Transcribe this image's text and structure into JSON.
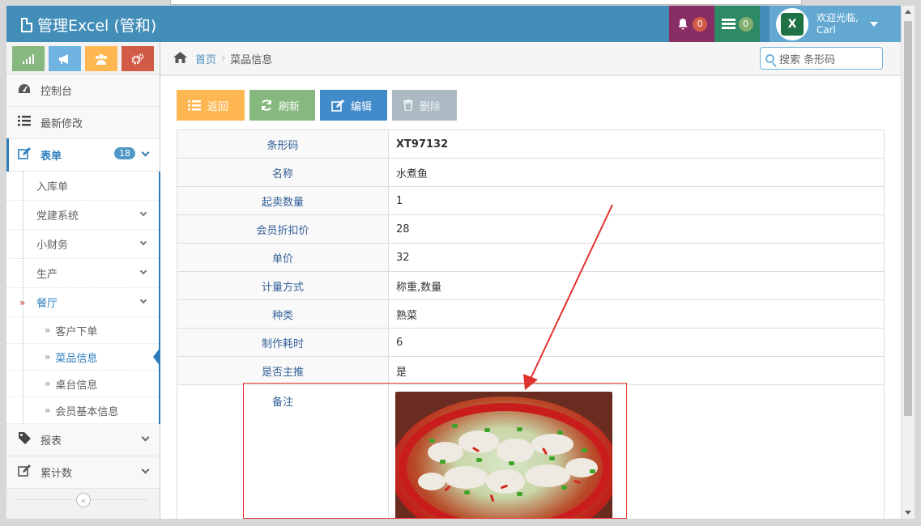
{
  "app": {
    "title": "管理Excel (管和)"
  },
  "navbar": {
    "notifications_count": "0",
    "tasks_count": "0",
    "user_greeting": "欢迎光临,",
    "user_name": "Carl",
    "avatar_text": "X"
  },
  "shortcuts": [
    {
      "icon": "signal-icon",
      "color": "#87b87f"
    },
    {
      "icon": "bullhorn-icon",
      "color": "#6fb3e0"
    },
    {
      "icon": "users-icon",
      "color": "#ffb752"
    },
    {
      "icon": "cogs-icon",
      "color": "#d15b47"
    }
  ],
  "sidebar": {
    "dashboard": "控制台",
    "recent": "最新修改",
    "forms": "表单",
    "forms_badge": "18",
    "sub": [
      "入库单",
      "党建系统",
      "小财务",
      "生产",
      "餐厅"
    ],
    "restaurant_sub": [
      "客户下单",
      "菜品信息",
      "桌台信息",
      "会员基本信息"
    ],
    "reports": "报表",
    "counter": "累计数",
    "collapse_glyph": "«"
  },
  "breadcrumb": {
    "home": "首页",
    "current": "菜品信息"
  },
  "search": {
    "placeholder": "搜索 条形码"
  },
  "toolbar": {
    "back": "返回",
    "refresh": "刷新",
    "edit": "编辑",
    "delete": "删除"
  },
  "details": [
    {
      "label": "条形码",
      "value": "XT97132"
    },
    {
      "label": "名称",
      "value": "水煮鱼"
    },
    {
      "label": "起卖数量",
      "value": "1"
    },
    {
      "label": "会员折扣价",
      "value": "28"
    },
    {
      "label": "单价",
      "value": "32"
    },
    {
      "label": "计量方式",
      "value": "称重,数量"
    },
    {
      "label": "种类",
      "value": "熟菜"
    },
    {
      "label": "制作耗时",
      "value": "6"
    },
    {
      "label": "是否主推",
      "value": "是"
    },
    {
      "label": "备注",
      "value": ""
    }
  ],
  "colors": {
    "navbar": "#438eb9",
    "accent": "#2b7dbc",
    "annotation": "#e0332d"
  }
}
